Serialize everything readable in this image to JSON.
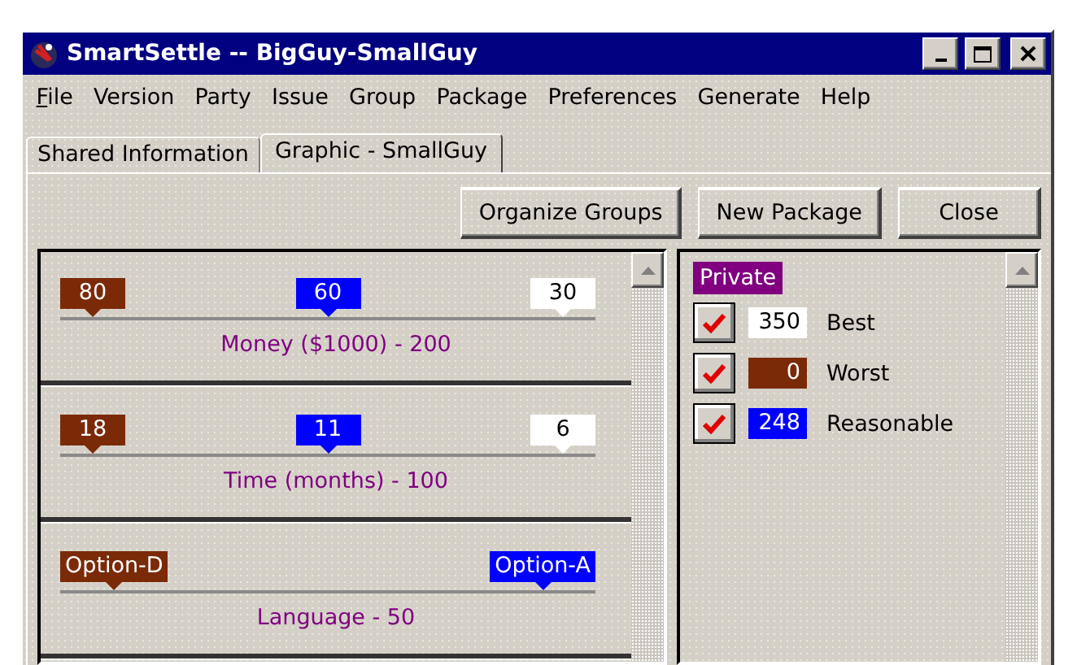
{
  "window": {
    "title": "SmartSettle -- BigGuy-SmallGuy"
  },
  "menu": [
    {
      "label": "File",
      "underlined": true
    },
    {
      "label": "Version",
      "underlined": false
    },
    {
      "label": "Party",
      "underlined": false
    },
    {
      "label": "Issue",
      "underlined": false
    },
    {
      "label": "Group",
      "underlined": false
    },
    {
      "label": "Package",
      "underlined": false
    },
    {
      "label": "Preferences",
      "underlined": false
    },
    {
      "label": "Generate",
      "underlined": false
    },
    {
      "label": "Help",
      "underlined": false
    }
  ],
  "tabs": [
    {
      "label": "Shared Information",
      "selected": false
    },
    {
      "label": "Graphic - SmallGuy",
      "selected": true
    }
  ],
  "buttons": [
    "Organize Groups",
    "New Package",
    "Close"
  ],
  "issues": [
    {
      "label": "Money ($1000) - 200",
      "markers": [
        {
          "text": "80",
          "color": "#7b2a08"
        },
        {
          "text": "60",
          "color": "#0000ff"
        },
        {
          "text": "30",
          "color": "#ffffff"
        }
      ]
    },
    {
      "label": "Time (months) - 100",
      "markers": [
        {
          "text": "18",
          "color": "#7b2a08"
        },
        {
          "text": "11",
          "color": "#0000ff"
        },
        {
          "text": "6",
          "color": "#ffffff"
        }
      ]
    },
    {
      "label": "Language - 50",
      "markers": [
        {
          "text": "Option-D",
          "color": "#7b2a08"
        },
        {
          "text": "Option-A",
          "color": "#0000ff"
        }
      ]
    }
  ],
  "private": {
    "heading": "Private",
    "rows": [
      {
        "checked": true,
        "value": "350",
        "color": "#ffffff",
        "label": "Best"
      },
      {
        "checked": true,
        "value": "0",
        "color": "#7b2a08",
        "label": "Worst"
      },
      {
        "checked": true,
        "value": "248",
        "color": "#0000ff",
        "label": "Reasonable"
      }
    ]
  }
}
